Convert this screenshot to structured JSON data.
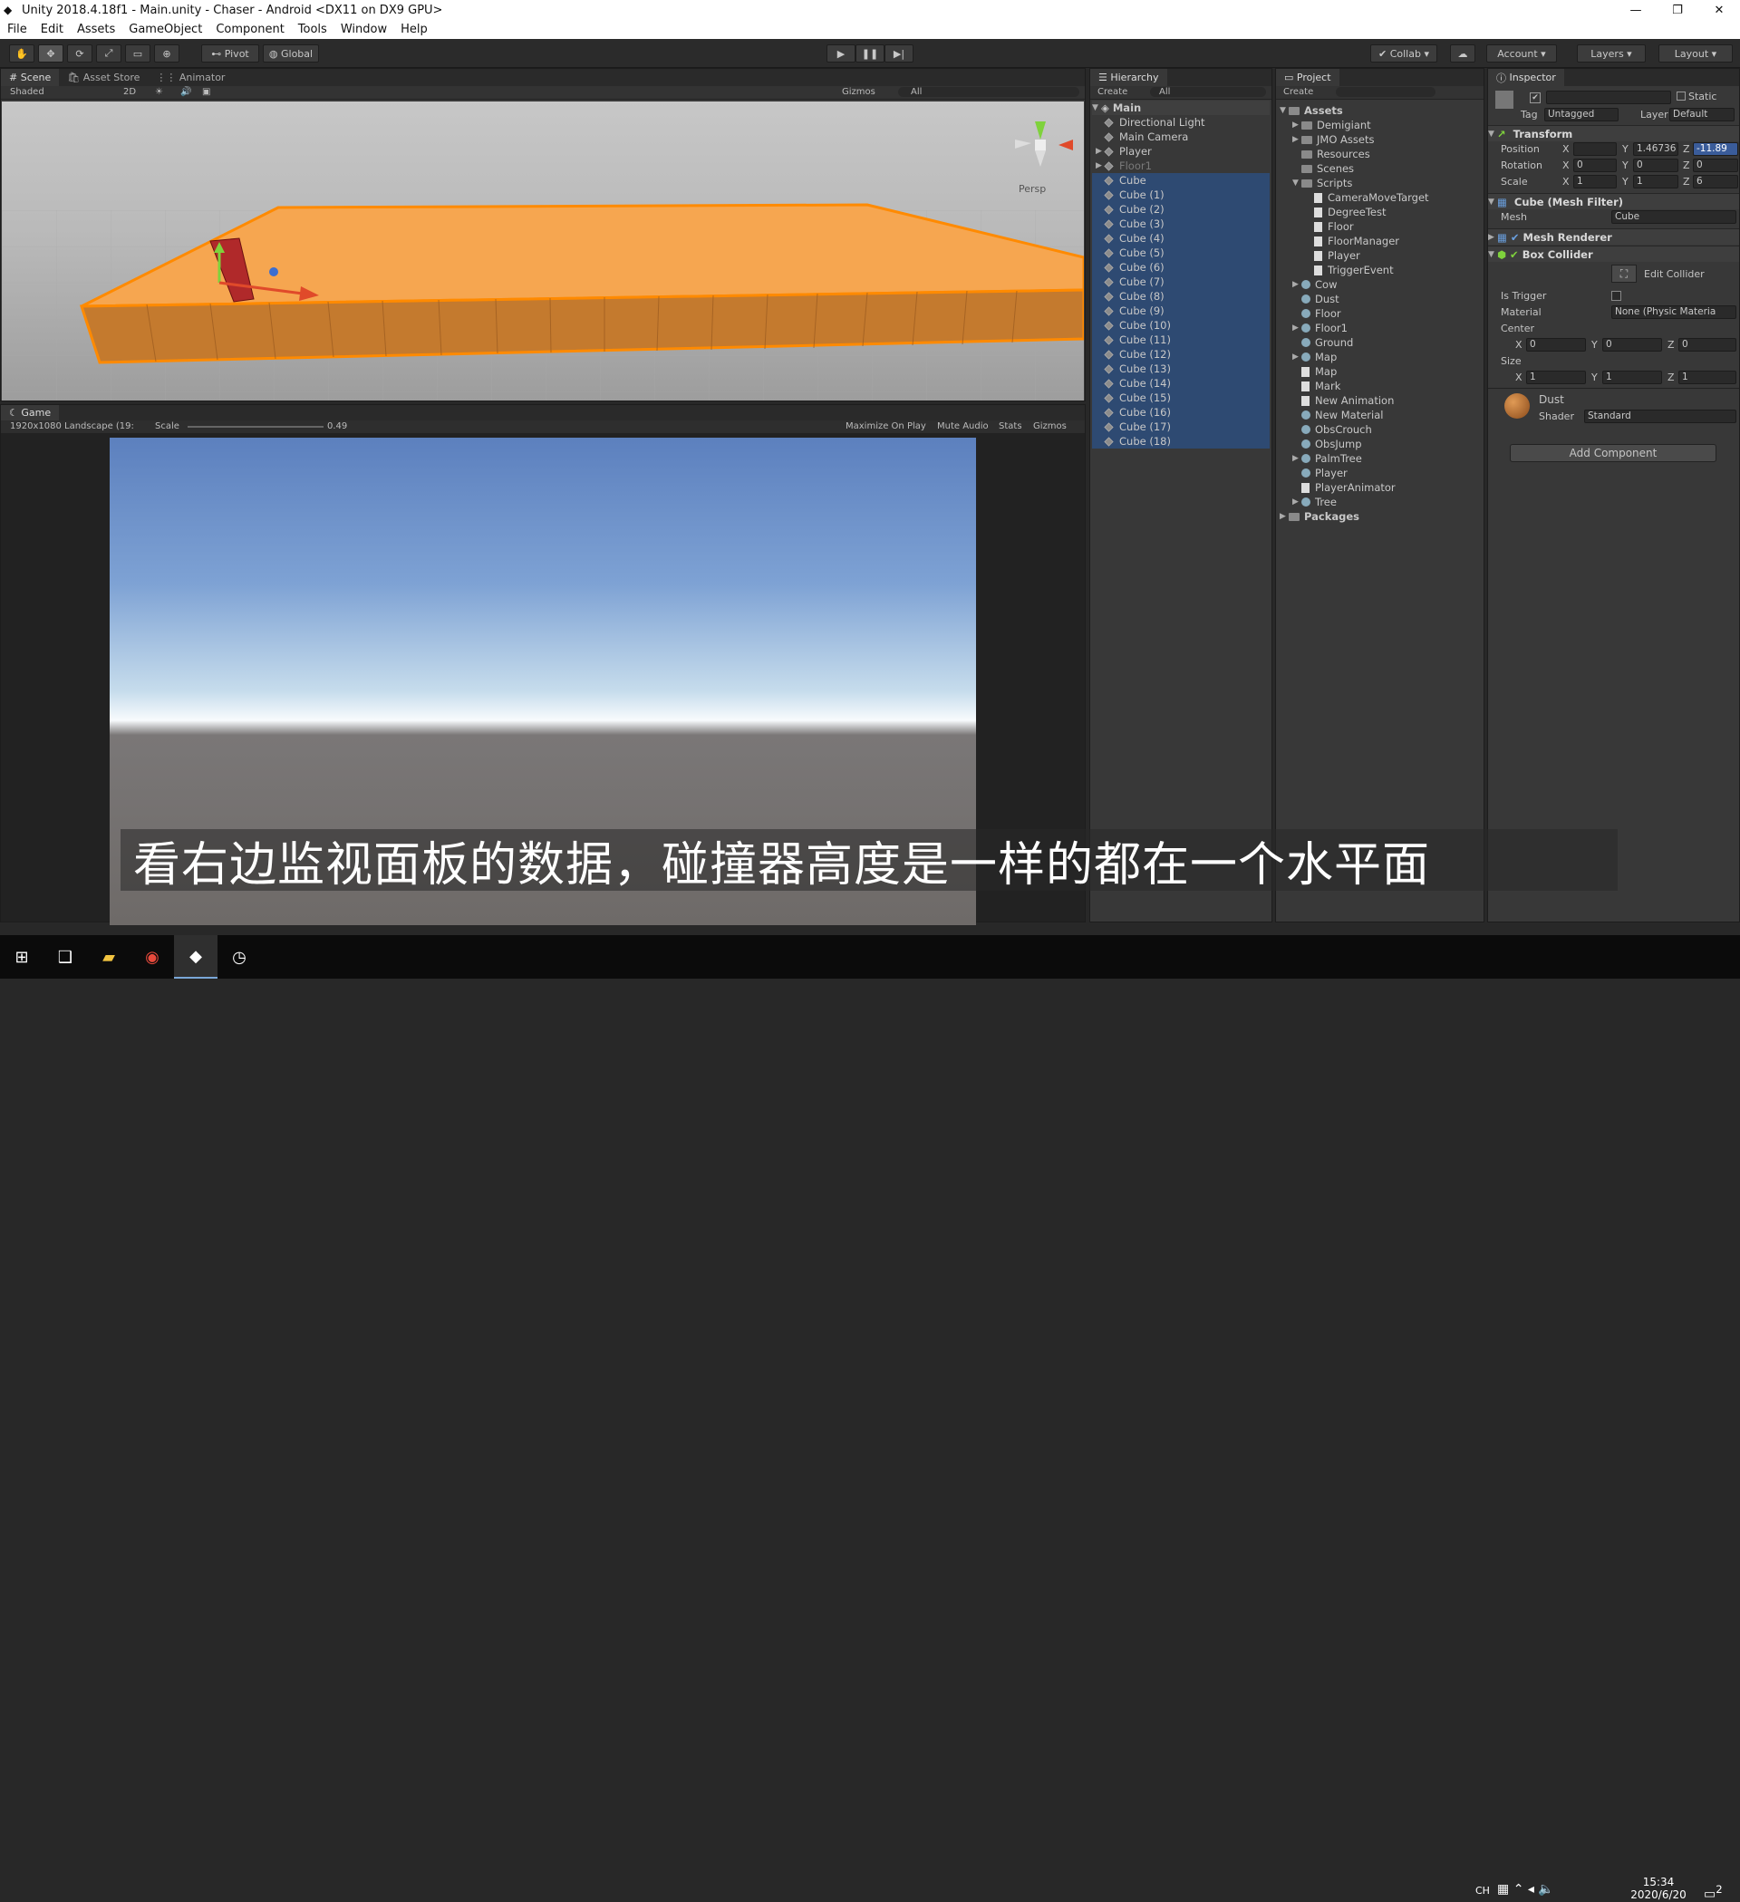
{
  "window": {
    "title": "Unity 2018.4.18f1 - Main.unity - Chaser - Android <DX11 on DX9 GPU>"
  },
  "menu": [
    "File",
    "Edit",
    "Assets",
    "GameObject",
    "Component",
    "Tools",
    "Window",
    "Help"
  ],
  "toolbar": {
    "pivot": "Pivot",
    "global": "Global",
    "collab": "Collab",
    "account": "Account",
    "layers": "Layers",
    "layout": "Layout"
  },
  "scene": {
    "tabs": [
      "Scene",
      "Asset Store",
      "Animator"
    ],
    "shading": "Shaded",
    "mode2d": "2D",
    "gizmos": "Gizmos",
    "search": "All",
    "persp": "Persp"
  },
  "game": {
    "tab": "Game",
    "resolution": "1920x1080 Landscape (19:",
    "scale_label": "Scale",
    "scale_value": "0.49",
    "maximize": "Maximize On Play",
    "mute": "Mute Audio",
    "stats": "Stats",
    "gizmos": "Gizmos"
  },
  "hierarchy": {
    "tab": "Hierarchy",
    "create": "Create",
    "search": "All",
    "scene": "Main",
    "items": [
      "Directional Light",
      "Main Camera",
      "Player",
      "Floor1",
      "Cube",
      "Cube (1)",
      "Cube (2)",
      "Cube (3)",
      "Cube (4)",
      "Cube (5)",
      "Cube (6)",
      "Cube (7)",
      "Cube (8)",
      "Cube (9)",
      "Cube (10)",
      "Cube (11)",
      "Cube (12)",
      "Cube (13)",
      "Cube (14)",
      "Cube (15)",
      "Cube (16)",
      "Cube (17)",
      "Cube (18)"
    ]
  },
  "project": {
    "tab": "Project",
    "create": "Create",
    "items": [
      "Assets",
      "Demigiant",
      "JMO Assets",
      "Resources",
      "Scenes",
      "Scripts",
      "CameraMoveTarget",
      "DegreeTest",
      "Floor",
      "FloorManager",
      "Player",
      "TriggerEvent",
      "Cow",
      "Dust",
      "Floor",
      "Floor1",
      "Ground",
      "Map",
      "Map",
      "Mark",
      "New Animation",
      "New Material",
      "ObsCrouch",
      "ObsJump",
      "PalmTree",
      "Player",
      "PlayerAnimator",
      "Tree",
      "Packages"
    ]
  },
  "inspector": {
    "tab": "Inspector",
    "static": "Static",
    "tag_label": "Tag",
    "tag": "Untagged",
    "layer_label": "Layer",
    "layer": "Default",
    "transform": {
      "title": "Transform",
      "position": {
        "label": "Position",
        "x": "",
        "y": "1.46736",
        "z": "-11.89"
      },
      "rotation": {
        "label": "Rotation",
        "x": "0",
        "y": "0",
        "z": "0"
      },
      "scale": {
        "label": "Scale",
        "x": "1",
        "y": "1",
        "z": "6"
      }
    },
    "mesh_filter": {
      "title": "Cube (Mesh Filter)",
      "mesh_label": "Mesh",
      "mesh": "Cube"
    },
    "mesh_renderer": {
      "title": "Mesh Renderer"
    },
    "box_collider": {
      "title": "Box Collider",
      "edit": "Edit Collider",
      "is_trigger": "Is Trigger",
      "material_label": "Material",
      "material": "None (Physic Materia",
      "center": "Center",
      "cx": "0",
      "cy": "0",
      "cz": "0",
      "size": "Size",
      "sx": "1",
      "sy": "1",
      "sz": "1"
    },
    "material": {
      "name": "Dust",
      "shader_label": "Shader",
      "shader": "Standard"
    },
    "add_component": "Add Component"
  },
  "subtitle": "看右边监视面板的数据，碰撞器高度是一样的都在一个水平面",
  "taskbar": {
    "ime": "CH",
    "time": "15:34",
    "date": "2020/6/20",
    "notif": "2"
  },
  "colors": {
    "selection": "#2e4a72",
    "floor": "#f49a3c",
    "accent": "#7aa7d8"
  }
}
